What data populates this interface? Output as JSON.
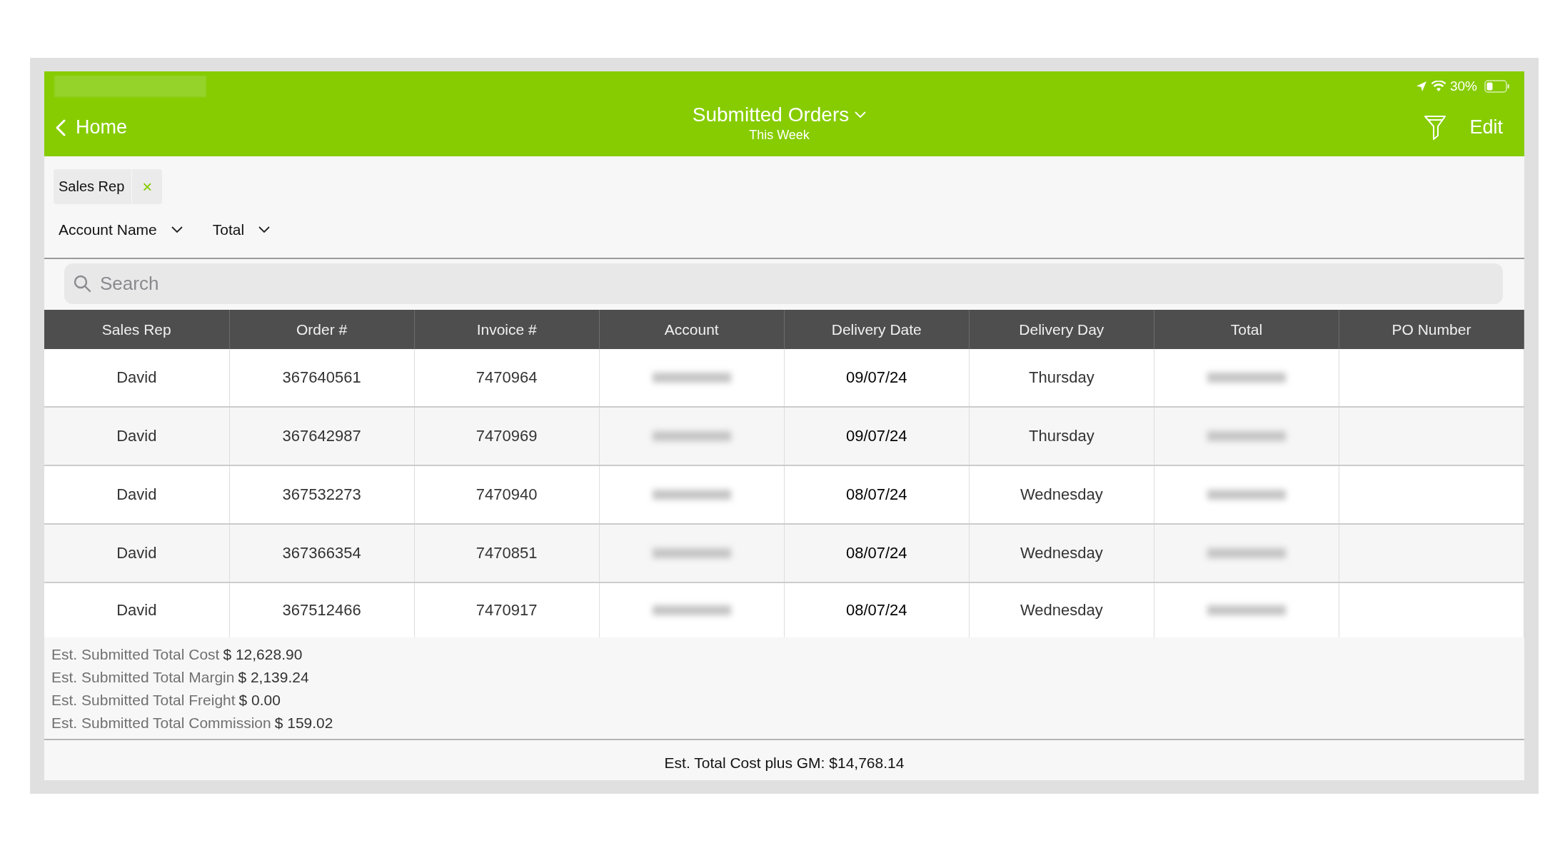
{
  "status_bar": {
    "battery": "30%"
  },
  "nav": {
    "back": "Home",
    "title": "Submitted Orders",
    "subtitle": "This Week",
    "edit": "Edit"
  },
  "filter_chips": [
    {
      "label": "Sales Rep",
      "remove": "×"
    }
  ],
  "sort_fields": [
    "Account Name",
    "Total"
  ],
  "search": {
    "placeholder": "Search"
  },
  "table": {
    "columns": [
      "Sales Rep",
      "Order #",
      "Invoice #",
      "Account",
      "Delivery Date",
      "Delivery Day",
      "Total",
      "PO Number"
    ],
    "rows": [
      {
        "sales_rep": "David",
        "order": "367640561",
        "invoice": "7470964",
        "delivery_date": "09/07/24",
        "delivery_day": "Thursday"
      },
      {
        "sales_rep": "David",
        "order": "367642987",
        "invoice": "7470969",
        "delivery_date": "09/07/24",
        "delivery_day": "Thursday"
      },
      {
        "sales_rep": "David",
        "order": "367532273",
        "invoice": "7470940",
        "delivery_date": "08/07/24",
        "delivery_day": "Wednesday"
      },
      {
        "sales_rep": "David",
        "order": "367366354",
        "invoice": "7470851",
        "delivery_date": "08/07/24",
        "delivery_day": "Wednesday"
      },
      {
        "sales_rep": "David",
        "order": "367512466",
        "invoice": "7470917",
        "delivery_date": "08/07/24",
        "delivery_day": "Wednesday"
      }
    ]
  },
  "summary": [
    {
      "label": "Est. Submitted Total Cost",
      "value": "$ 12,628.90"
    },
    {
      "label": "Est. Submitted Total Margin",
      "value": "$ 2,139.24"
    },
    {
      "label": "Est. Submitted Total Freight",
      "value": "$ 0.00"
    },
    {
      "label": "Est. Submitted Total Commission",
      "value": "$ 159.02"
    }
  ],
  "footer": "Est. Total Cost plus GM: $14,768.14"
}
